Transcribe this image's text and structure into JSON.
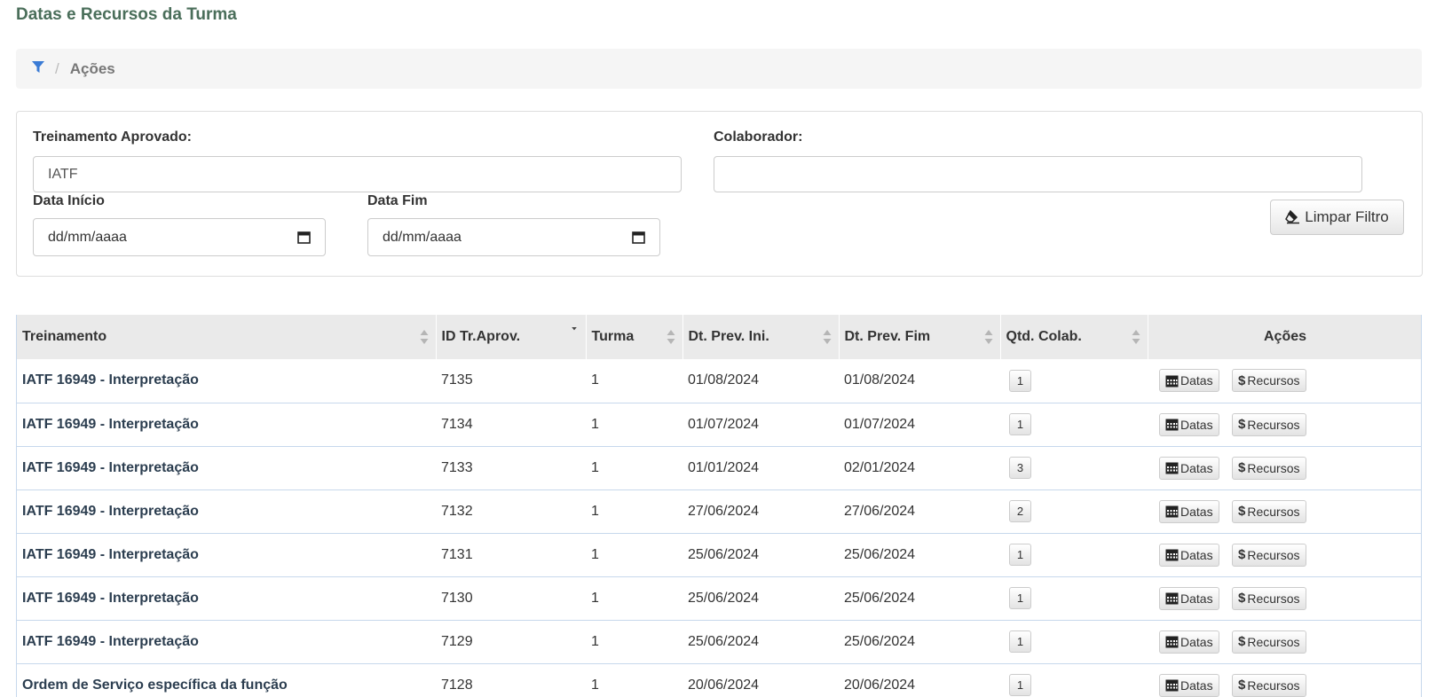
{
  "page": {
    "title": "Datas e Recursos da Turma"
  },
  "breadcrumb": {
    "icon": "filter-icon",
    "separator": "/",
    "current": "Ações"
  },
  "filters": {
    "treinamento_label": "Treinamento Aprovado:",
    "treinamento_value": "IATF",
    "colaborador_label": "Colaborador:",
    "colaborador_value": "",
    "data_inicio_label": "Data Início",
    "data_inicio_placeholder": "dd/mm/aaaa",
    "data_fim_label": "Data Fim",
    "data_fim_placeholder": "dd/mm/aaaa",
    "clear_button": "Limpar Filtro"
  },
  "table": {
    "columns": [
      "Treinamento",
      "ID Tr.Aprov.",
      "Turma",
      "Dt. Prev. Ini.",
      "Dt. Prev. Fim",
      "Qtd. Colab.",
      "Ações"
    ],
    "rows": [
      {
        "treinamento": "IATF 16949 - Interpretação",
        "id": "7135",
        "turma": "1",
        "ini": "01/08/2024",
        "fim": "01/08/2024",
        "qtd": "1"
      },
      {
        "treinamento": "IATF 16949 - Interpretação",
        "id": "7134",
        "turma": "1",
        "ini": "01/07/2024",
        "fim": "01/07/2024",
        "qtd": "1"
      },
      {
        "treinamento": "IATF 16949 - Interpretação",
        "id": "7133",
        "turma": "1",
        "ini": "01/01/2024",
        "fim": "02/01/2024",
        "qtd": "3"
      },
      {
        "treinamento": "IATF 16949 - Interpretação",
        "id": "7132",
        "turma": "1",
        "ini": "27/06/2024",
        "fim": "27/06/2024",
        "qtd": "2"
      },
      {
        "treinamento": "IATF 16949 - Interpretação",
        "id": "7131",
        "turma": "1",
        "ini": "25/06/2024",
        "fim": "25/06/2024",
        "qtd": "1"
      },
      {
        "treinamento": "IATF 16949 - Interpretação",
        "id": "7130",
        "turma": "1",
        "ini": "25/06/2024",
        "fim": "25/06/2024",
        "qtd": "1"
      },
      {
        "treinamento": "IATF 16949 - Interpretação",
        "id": "7129",
        "turma": "1",
        "ini": "25/06/2024",
        "fim": "25/06/2024",
        "qtd": "1"
      },
      {
        "treinamento": "Ordem de Serviço específica da função",
        "id": "7128",
        "turma": "1",
        "ini": "20/06/2024",
        "fim": "20/06/2024",
        "qtd": "1"
      }
    ],
    "action_datas": "Datas",
    "action_recursos": "Recursos",
    "dollar_symbol": "$"
  },
  "colors": {
    "title": "#4a6e5a",
    "filter_icon": "#3a7bd5",
    "row_border": "#c7d8ec"
  }
}
